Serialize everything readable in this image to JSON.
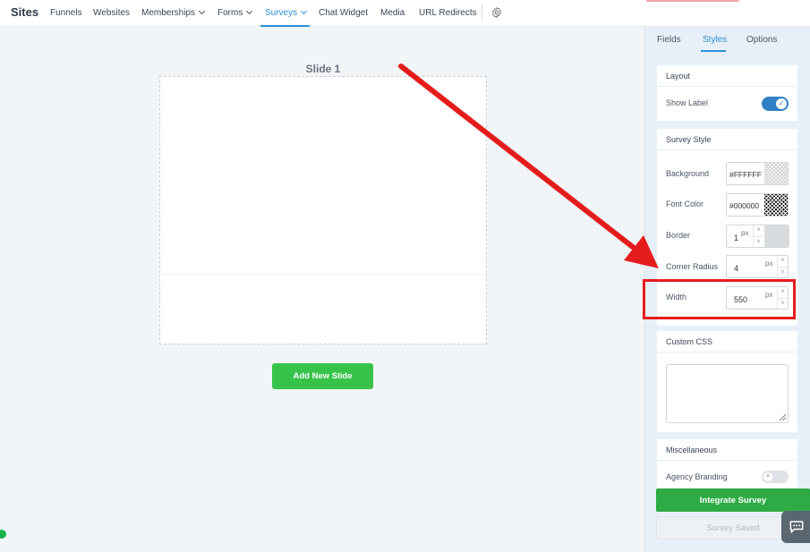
{
  "nav": {
    "brand": "Sites",
    "items": [
      "Funnels",
      "Websites",
      "Memberships",
      "Forms",
      "Surveys",
      "Chat Widget",
      "Media",
      "URL Redirects"
    ],
    "active": "Surveys"
  },
  "canvas": {
    "slide_title": "Slide 1",
    "add_slide_label": "Add New Slide"
  },
  "panel": {
    "tabs": [
      "Fields",
      "Styles",
      "Options"
    ],
    "active_tab": "Styles",
    "layout": {
      "heading": "Layout",
      "show_label": "Show Label",
      "show_label_on": true
    },
    "survey_style": {
      "heading": "Survey Style",
      "background_label": "Background",
      "background_value": "#FFFFFF",
      "font_color_label": "Font Color",
      "font_color_value": "#000000",
      "border_label": "Border",
      "border_value": "1",
      "border_unit": "px",
      "corner_radius_label": "Corner Radius",
      "corner_radius_value": "4",
      "corner_radius_unit": "px",
      "width_label": "Width",
      "width_value": "550",
      "width_unit": "px"
    },
    "custom_css": {
      "heading": "Custom CSS",
      "value": ""
    },
    "misc": {
      "heading": "Miscellaneous",
      "agency_branding": "Agency Branding",
      "agency_branding_on": false
    },
    "integrate_label": "Integrate Survey",
    "saved_label": "Survey Saved"
  },
  "colors": {
    "accent": "#2d8fd5",
    "primary_button": "#37c34a",
    "integrate_button": "#2eab45",
    "annotation": "#e51c1c"
  }
}
